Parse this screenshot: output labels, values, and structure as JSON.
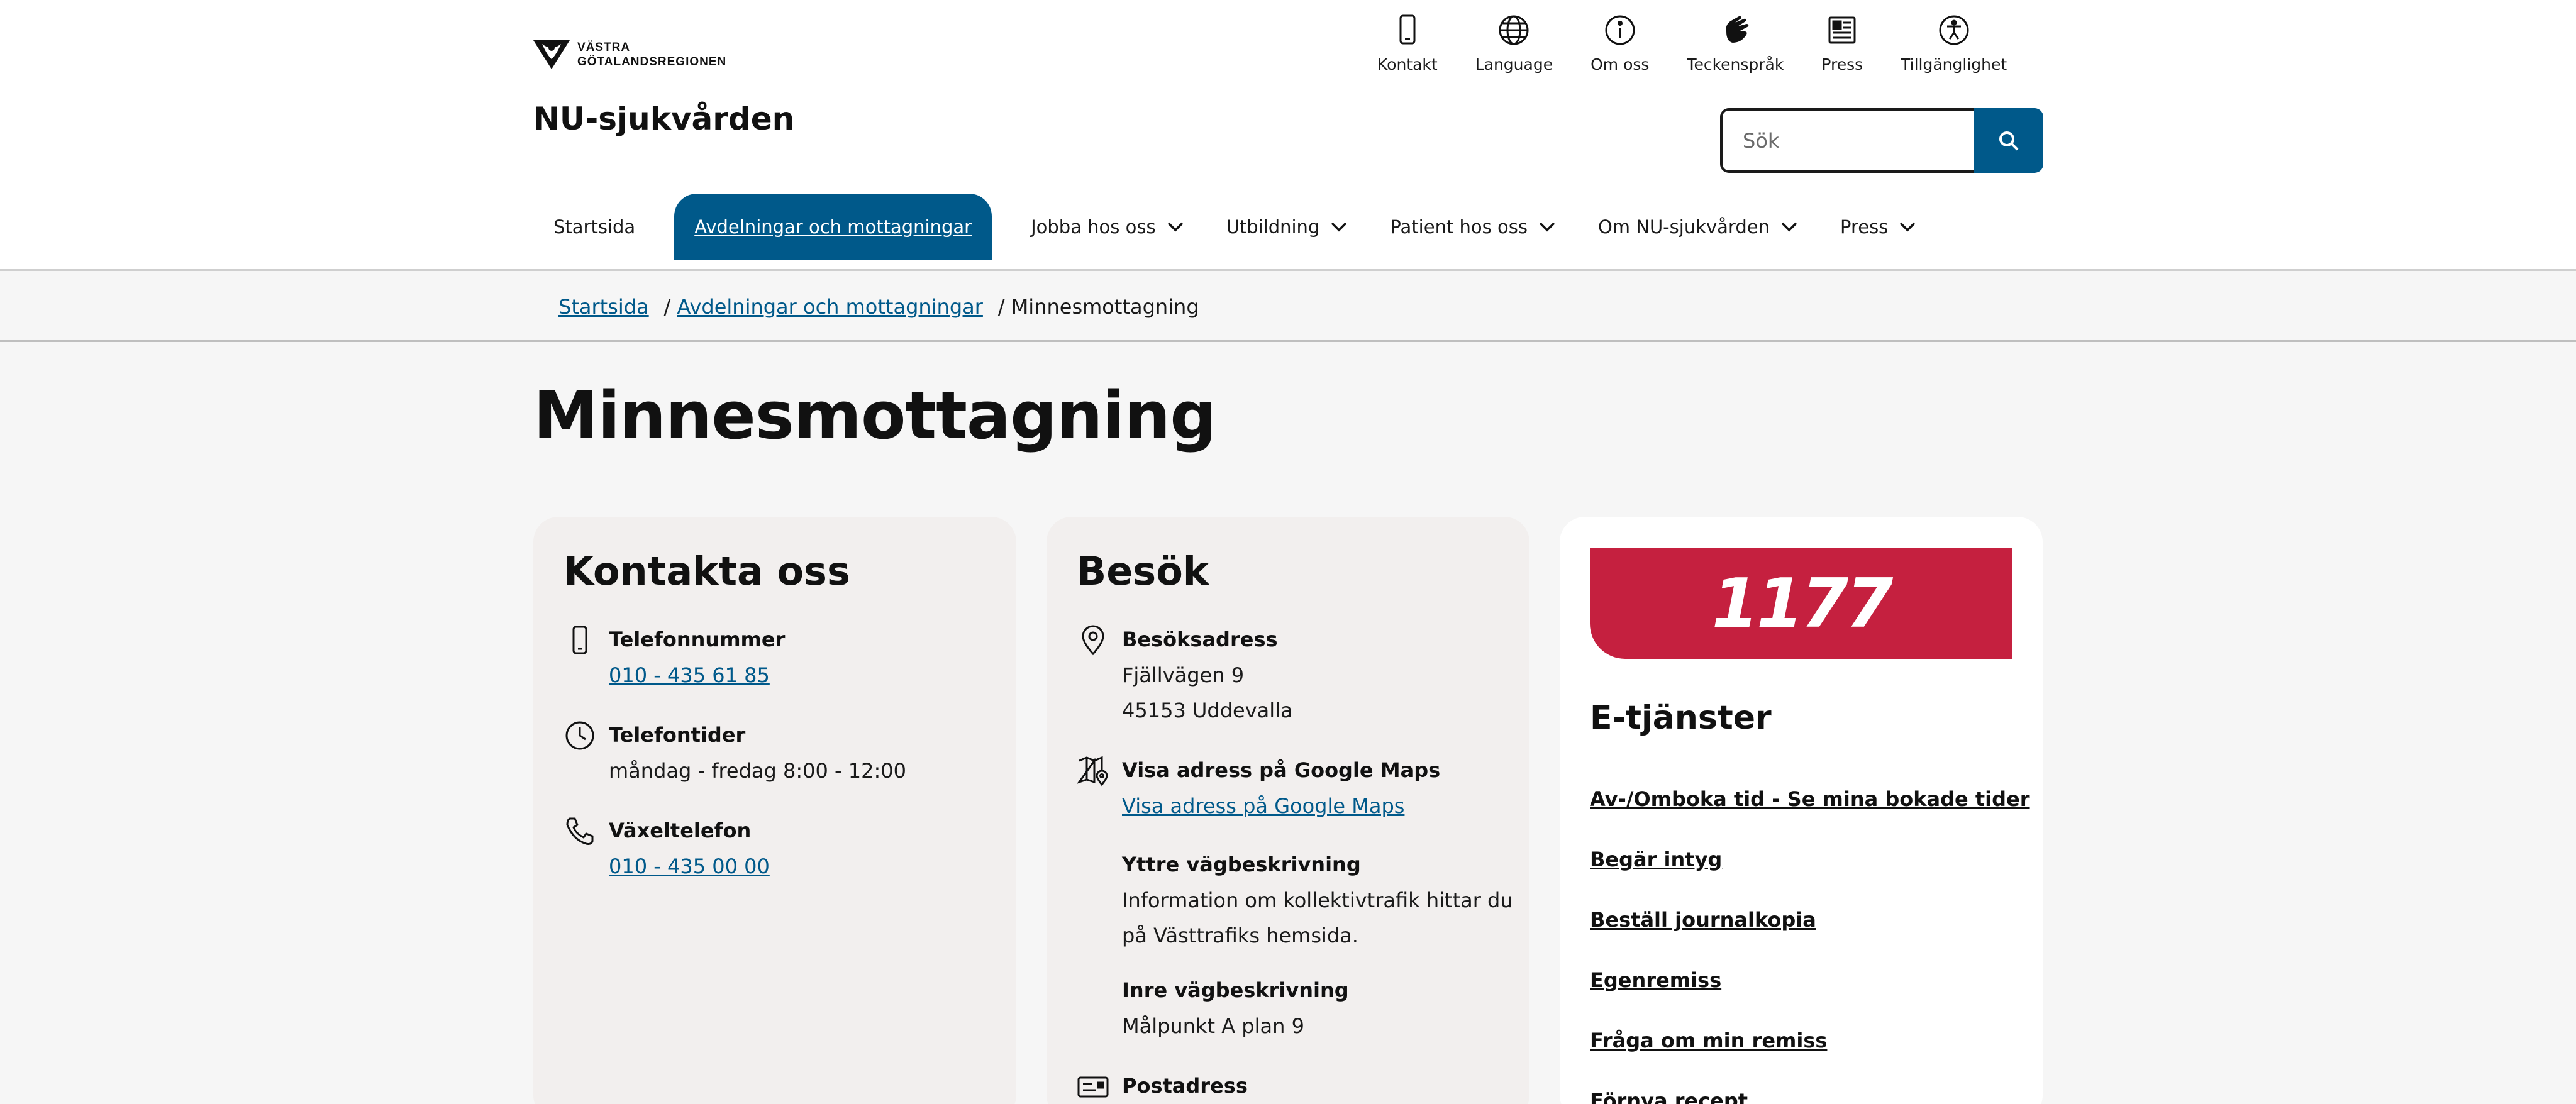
{
  "header": {
    "logo_text_line1": "VÄSTRA",
    "logo_text_line2": "GÖTALANDSREGIONEN",
    "site_title": "NU-sjukvården",
    "utility_nav": [
      {
        "label": "Kontakt",
        "icon": "phone-icon"
      },
      {
        "label": "Language",
        "icon": "globe-icon"
      },
      {
        "label": "Om oss",
        "icon": "info-icon"
      },
      {
        "label": "Teckenspråk",
        "icon": "sign-language-icon"
      },
      {
        "label": "Press",
        "icon": "newspaper-icon"
      },
      {
        "label": "Tillgänglighet",
        "icon": "accessibility-icon"
      }
    ],
    "search": {
      "placeholder": "Sök",
      "value": ""
    }
  },
  "main_nav": [
    {
      "label": "Startsida",
      "has_dropdown": false,
      "active": false
    },
    {
      "label": "Avdelningar och mottagningar",
      "has_dropdown": false,
      "active": true
    },
    {
      "label": "Jobba hos oss",
      "has_dropdown": true,
      "active": false
    },
    {
      "label": "Utbildning",
      "has_dropdown": true,
      "active": false
    },
    {
      "label": "Patient hos oss",
      "has_dropdown": true,
      "active": false
    },
    {
      "label": "Om NU-sjukvården",
      "has_dropdown": true,
      "active": false
    },
    {
      "label": "Press",
      "has_dropdown": true,
      "active": false
    }
  ],
  "breadcrumb": {
    "items": [
      "Startsida",
      "Avdelningar och mottagningar"
    ],
    "separator": "/",
    "current": "Minnesmottagning"
  },
  "page_title": "Minnesmottagning",
  "contact_card": {
    "heading": "Kontakta oss",
    "rows": [
      {
        "label": "Telefonnummer",
        "value": "010 - 435 61 85",
        "icon": "mobile-phone-icon"
      },
      {
        "label": "Telefontider",
        "value": "måndag - fredag 8:00 - 12:00",
        "icon": "clock-icon"
      },
      {
        "label": "Växeltelefon",
        "value": "010 - 435 00 00",
        "icon": "phone-handset-icon"
      }
    ]
  },
  "visit_card": {
    "heading": "Besök",
    "address_label": "Besöksadress",
    "address_line1": "Fjällvägen 9",
    "address_line2": "45153 Uddevalla",
    "maps_label": "Visa adress på Google Maps",
    "maps_link": "Visa adress på Google Maps",
    "outer_label": "Yttre vägbeskrivning",
    "outer_line1": "Information om kollektivtrafik hittar du",
    "outer_line2": "på Västtrafiks hemsida.",
    "inner_label": "Inre vägbeskrivning",
    "inner_text": "Målpunkt A plan 9",
    "postal_label": "Postadress"
  },
  "eservices_card": {
    "banner": "1177",
    "heading": "E-tjänster",
    "links": [
      "Av-/Omboka tid - Se mina bokade tider",
      "Begär intyg",
      "Beställ journalkopia",
      "Egenremiss",
      "Fråga om min remiss",
      "Förnya recept"
    ]
  },
  "colors": {
    "brand_blue": "#00598a",
    "brand_red_1177": "#c5203f",
    "card_bg": "#f2efee",
    "page_bg": "#f6f6f6"
  }
}
